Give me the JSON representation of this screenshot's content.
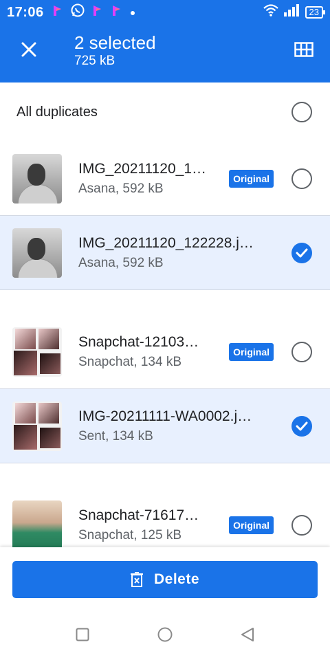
{
  "status_bar": {
    "time": "17:06",
    "battery": "23",
    "icons": [
      "notification-app-icon",
      "whatsapp-icon",
      "notification-app-icon",
      "notification-app-icon",
      "dot-icon",
      "wifi-icon",
      "signal-icon",
      "battery-icon"
    ]
  },
  "app_bar": {
    "title": "2 selected",
    "subtitle": "725 kB",
    "close_icon": "close-icon",
    "grid_icon": "grid-view-icon"
  },
  "all_duplicates": {
    "label": "All duplicates",
    "checked": false
  },
  "groups": [
    {
      "items": [
        {
          "name": "IMG_20211120_1…",
          "meta": "Asana, 592 kB",
          "badge": "Original",
          "checked": false
        },
        {
          "name": "IMG_20211120_122228.j…",
          "meta": "Asana, 592 kB",
          "badge": "",
          "checked": true
        }
      ]
    },
    {
      "items": [
        {
          "name": "Snapchat-12103…",
          "meta": "Snapchat, 134 kB",
          "badge": "Original",
          "checked": false
        },
        {
          "name": "IMG-20211111-WA0002.j…",
          "meta": "Sent, 134 kB",
          "badge": "",
          "checked": true
        }
      ]
    },
    {
      "items": [
        {
          "name": "Snapchat-71617…",
          "meta": "Snapchat, 125 kB",
          "badge": "Original",
          "checked": false
        }
      ]
    }
  ],
  "delete_button": {
    "label": "Delete",
    "icon": "trash-icon"
  },
  "nav_bar": {
    "icons": [
      "recents-square-icon",
      "home-circle-icon",
      "back-triangle-icon"
    ]
  },
  "colors": {
    "accent": "#1a73e8",
    "selected_row": "#e8f0fe",
    "text_primary": "#202124",
    "text_secondary": "#5f6368"
  }
}
